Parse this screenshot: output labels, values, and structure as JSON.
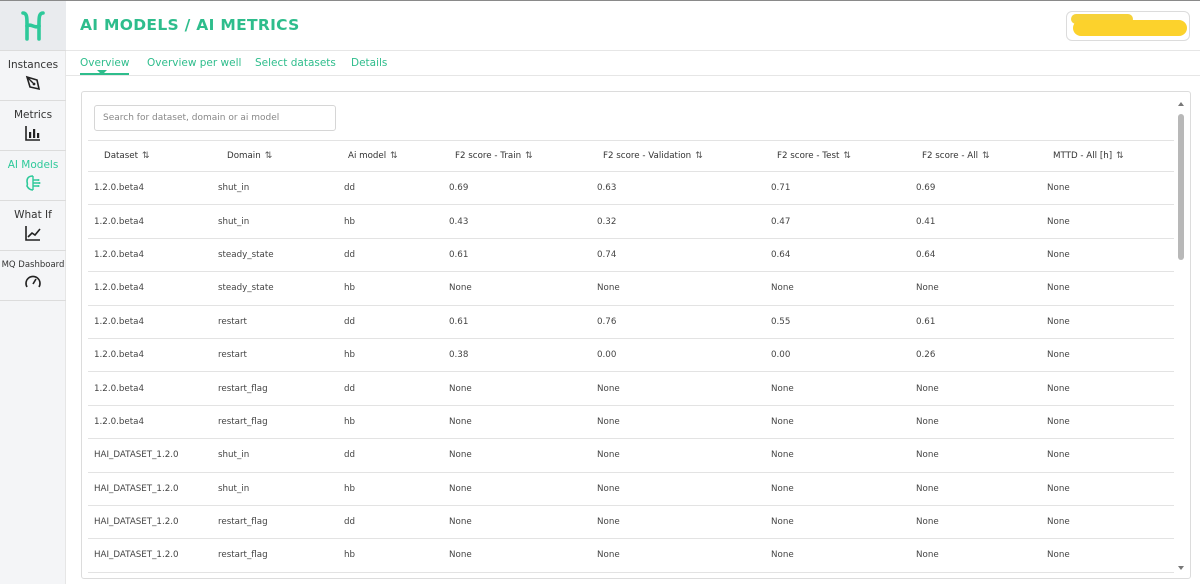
{
  "app": {
    "accent_color": "#2ebd8c",
    "logo_icon": "h-logo-icon"
  },
  "sidebar": {
    "items": [
      {
        "label": "Instances",
        "icon": "pen-tool-icon",
        "active": false
      },
      {
        "label": "Metrics",
        "icon": "bar-chart-icon",
        "active": false
      },
      {
        "label": "AI Models",
        "icon": "brain-icon",
        "active": true
      },
      {
        "label": "What If",
        "icon": "line-chart-icon",
        "active": false
      },
      {
        "label": "MQ Dashboard",
        "icon": "gauge-icon",
        "active": false
      }
    ]
  },
  "header": {
    "title": "AI MODELS / AI METRICS"
  },
  "tabs": [
    {
      "label": "Overview",
      "active": true
    },
    {
      "label": "Overview per well",
      "active": false
    },
    {
      "label": "Select datasets",
      "active": false
    },
    {
      "label": "Details",
      "active": false
    }
  ],
  "search": {
    "placeholder": "Search for dataset, domain or ai model"
  },
  "table": {
    "sort_icon": "⇅",
    "columns": [
      "Dataset",
      "Domain",
      "Ai model",
      "F2 score - Train",
      "F2 score - Validation",
      "F2 score - Test",
      "F2 score - All",
      "MTTD - All [h]"
    ],
    "rows": [
      [
        "1.2.0.beta4",
        "shut_in",
        "dd",
        "0.69",
        "0.63",
        "0.71",
        "0.69",
        "None"
      ],
      [
        "1.2.0.beta4",
        "shut_in",
        "hb",
        "0.43",
        "0.32",
        "0.47",
        "0.41",
        "None"
      ],
      [
        "1.2.0.beta4",
        "steady_state",
        "dd",
        "0.61",
        "0.74",
        "0.64",
        "0.64",
        "None"
      ],
      [
        "1.2.0.beta4",
        "steady_state",
        "hb",
        "None",
        "None",
        "None",
        "None",
        "None"
      ],
      [
        "1.2.0.beta4",
        "restart",
        "dd",
        "0.61",
        "0.76",
        "0.55",
        "0.61",
        "None"
      ],
      [
        "1.2.0.beta4",
        "restart",
        "hb",
        "0.38",
        "0.00",
        "0.00",
        "0.26",
        "None"
      ],
      [
        "1.2.0.beta4",
        "restart_flag",
        "dd",
        "None",
        "None",
        "None",
        "None",
        "None"
      ],
      [
        "1.2.0.beta4",
        "restart_flag",
        "hb",
        "None",
        "None",
        "None",
        "None",
        "None"
      ],
      [
        "HAI_DATASET_1.2.0",
        "shut_in",
        "dd",
        "None",
        "None",
        "None",
        "None",
        "None"
      ],
      [
        "HAI_DATASET_1.2.0",
        "shut_in",
        "hb",
        "None",
        "None",
        "None",
        "None",
        "None"
      ],
      [
        "HAI_DATASET_1.2.0",
        "restart_flag",
        "dd",
        "None",
        "None",
        "None",
        "None",
        "None"
      ],
      [
        "HAI_DATASET_1.2.0",
        "restart_flag",
        "hb",
        "None",
        "None",
        "None",
        "None",
        "None"
      ]
    ]
  }
}
